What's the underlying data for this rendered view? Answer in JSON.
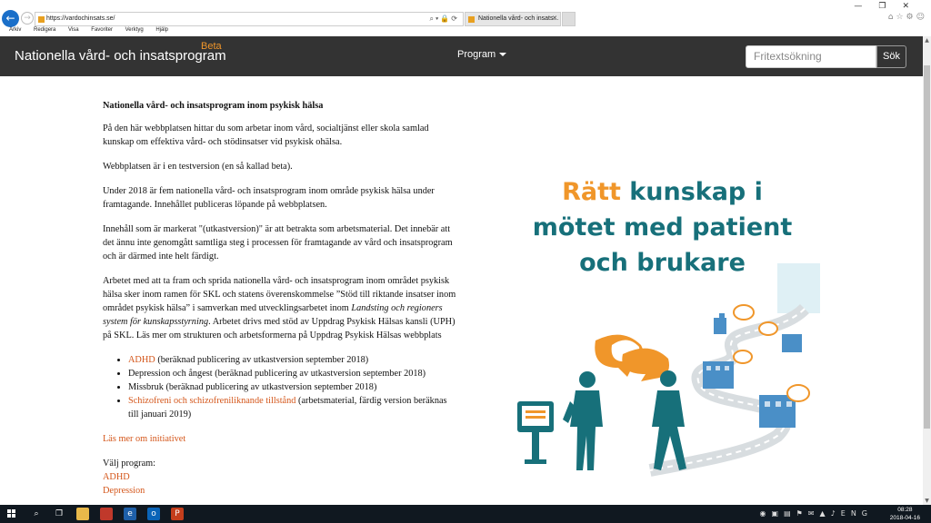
{
  "browser": {
    "url": "https://vardochinsats.se/",
    "tab_title": "Nationella vård- och insats...",
    "tab_close": "✕",
    "menu": [
      "Arkiv",
      "Redigera",
      "Visa",
      "Favoriter",
      "Verktyg",
      "Hjälp"
    ],
    "window_controls": [
      "—",
      "❐",
      "✕"
    ]
  },
  "header": {
    "site_title": "Nationella vård- och insatsprogram",
    "beta_label": "Beta",
    "program_menu": "Program",
    "search_placeholder": "Fritextsökning",
    "search_button": "Sök"
  },
  "content": {
    "heading": "Nationella vård- och insatsprogram inom psykisk hälsa",
    "p1": "På den här webbplatsen hittar du som arbetar inom vård, socialtjänst eller skola samlad kunskap om effektiva vård- och stödinsatser vid psykisk ohälsa.",
    "p2": "Webbplatsen är i en testversion (en så kallad beta).",
    "p3": "Under 2018 är fem nationella vård- och insatsprogram inom område psykisk hälsa under framtagande. Innehållet publiceras löpande på webbplatsen.",
    "p4": "Innehåll som är markerat \"(utkastversion)\" är att betrakta som arbetsmaterial. Det innebär att det ännu inte genomgått samtliga steg i processen för framtagande av vård och insatsprogram och är därmed inte helt färdigt.",
    "p5_a": "Arbetet med att ta fram och sprida nationella vård- och insatsprogram inom området psykisk hälsa sker inom ramen för SKL och statens överenskommelse ”Stöd till riktande insatser inom området psykisk hälsa” i samverkan med utvecklingsarbetet inom ",
    "p5_em": "Landsting och regioners system för kunskapsstyrning",
    "p5_b": ". Arbetet drivs med stöd av Uppdrag Psykisk Hälsas kansli (UPH) på SKL. Läs mer om strukturen och arbetsformerna på Uppdrag Psykisk Hälsas webbplats",
    "list": [
      {
        "link": "ADHD",
        "text": " (beräknad publicering av utkastversion september 2018)"
      },
      {
        "link": "",
        "text": "Depression och ångest (beräknad publicering av utkastversion september 2018)"
      },
      {
        "link": "",
        "text": "Missbruk (beräknad publicering av utkastversion september 2018)"
      },
      {
        "link": "Schizofreni och schizofreniliknande tillstånd",
        "text": " (arbetsmaterial, färdig version beräknas till januari 2019)"
      }
    ],
    "read_more": "Läs mer om initiativet",
    "choose_program": "Välj program:",
    "programs": [
      "ADHD",
      "Depression"
    ]
  },
  "hero": {
    "line1_accent": "Rätt",
    "line1_rest": " kunskap i",
    "line2": "mötet med patient",
    "line3": "och brukare"
  },
  "taskbar": {
    "time": "08:28",
    "date": "2018-04-16"
  },
  "colors": {
    "header_bg": "#333333",
    "link": "#d4561a",
    "hero_teal": "#17707a",
    "hero_orange": "#f0962a"
  }
}
